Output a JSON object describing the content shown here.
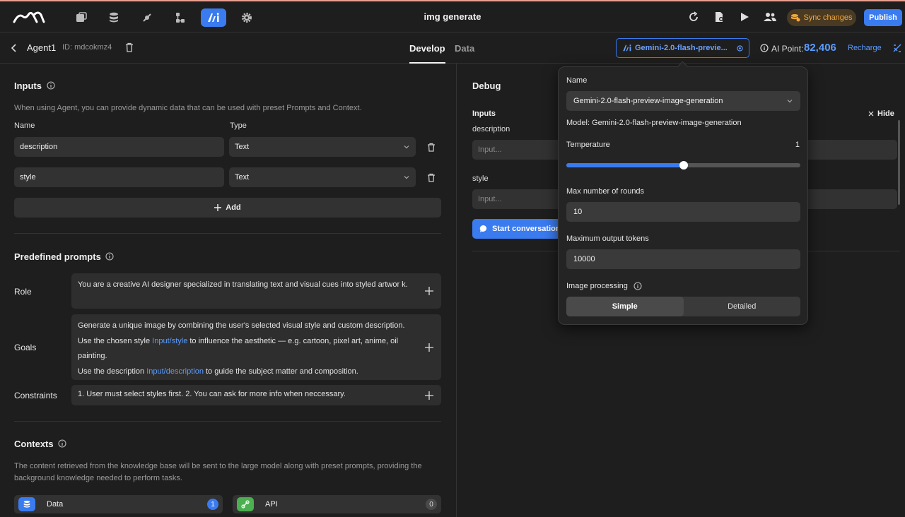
{
  "app": {
    "title": "img generate"
  },
  "toolbar": {
    "sync_label": "Sync changes",
    "publish_label": "Publish"
  },
  "agent": {
    "name": "Agent1",
    "id": "ID: mdcokmz4"
  },
  "tabs": [
    {
      "label": "Develop"
    },
    {
      "label": "Data"
    }
  ],
  "model_chip": {
    "label": "Gemini-2.0-flash-previe..."
  },
  "ai_point": {
    "label": "AI Point:",
    "value": "82,406",
    "recharge": "Recharge"
  },
  "inputs": {
    "title": "Inputs",
    "description": "When using Agent, you can provide dynamic data that can be used with preset Prompts and Context.",
    "col_name": "Name",
    "col_type": "Type",
    "rows": [
      {
        "name": "description",
        "type": "Text"
      },
      {
        "name": "style",
        "type": "Text"
      }
    ],
    "add_label": "Add"
  },
  "prompts": {
    "title": "Predefined prompts",
    "role_label": "Role",
    "role_text": "You are a creative AI designer specialized in translating text and visual cues into styled artwor k.",
    "goals_label": "Goals",
    "goals_l1": "Generate a unique image by combining the user's selected visual style and custom description.",
    "goals_l2a": "Use the chosen style ",
    "goals_var1": "Input/style",
    "goals_l2b": " to influence the aesthetic — e.g. cartoon, pixel art, anime, oil painting.",
    "goals_l3a": "Use the description ",
    "goals_var2": "Input/description",
    "goals_l3b": " to guide the subject matter and composition.",
    "constraints_label": "Constraints",
    "constraints_text": "1. User must select styles first. 2. You can ask for more info when neccessary."
  },
  "contexts": {
    "title": "Contexts",
    "description": "The content retrieved from the knowledge base will be sent to the large model along with preset prompts, providing the background knowledge needed to perform tasks.",
    "items": [
      {
        "label": "Data",
        "count": "1"
      },
      {
        "label": "API",
        "count": "0"
      }
    ]
  },
  "debug": {
    "title": "Debug",
    "inputs_label": "Inputs",
    "hide_label": "Hide",
    "fields": [
      {
        "label": "description",
        "placeholder": "Input..."
      },
      {
        "label": "style",
        "placeholder": "Input..."
      }
    ],
    "start_label": "Start conversation"
  },
  "model_popup": {
    "name_label": "Name",
    "name_value": "Gemini-2.0-flash-preview-image-generation",
    "model_text": "Model: Gemini-2.0-flash-preview-image-generation",
    "temperature_label": "Temperature",
    "temperature_value": "1",
    "temperature_fraction": 0.5,
    "max_rounds_label": "Max number of rounds",
    "max_rounds_value": "10",
    "max_tokens_label": "Maximum output tokens",
    "max_tokens_value": "10000",
    "image_processing_label": "Image processing",
    "image_options": [
      "Simple",
      "Detailed"
    ]
  },
  "colors": {
    "accent": "#3a7bf0",
    "sync_bg": "#4a3a22",
    "sync_text": "#f0a840",
    "data_icon": "#3a7bf0",
    "api_icon": "#4caf50"
  },
  "icons": {
    "nav": [
      "files-icon",
      "database-icon",
      "plugin-icon",
      "workflow-icon",
      "ai-icon",
      "gear-icon"
    ],
    "top_right": [
      "refresh-icon",
      "document-settings-icon",
      "play-icon",
      "users-icon"
    ]
  }
}
